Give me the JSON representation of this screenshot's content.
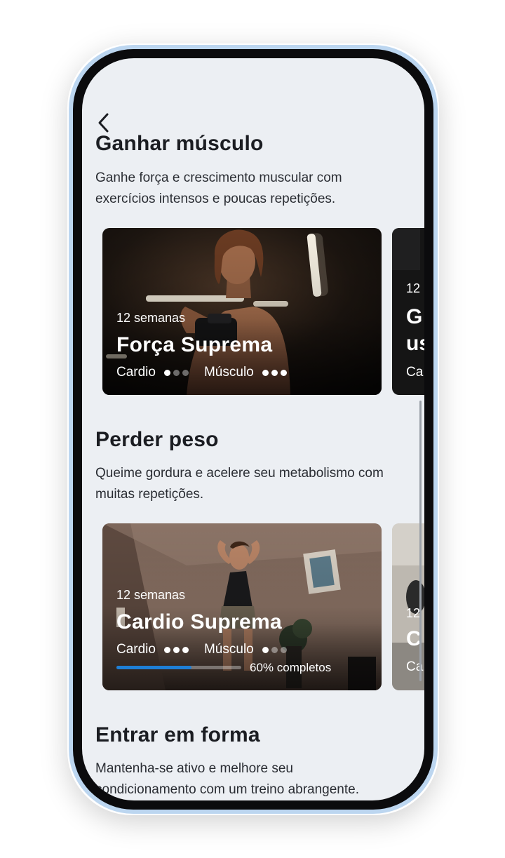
{
  "colors": {
    "screen_bg": "#eceff3",
    "text_primary": "#1b1d22",
    "frame_accent": "#bcd6f0",
    "progress_fill": "#1e7fd6"
  },
  "nav": {
    "back_icon": "chevron-left-icon"
  },
  "sections": [
    {
      "title": "Ganhar músculo",
      "description": "Ganhe força e crescimento muscular com exercícios intensos e poucas repetições.",
      "card": {
        "weeks": "12 semanas",
        "title": "Força Suprema",
        "cardio_label": "Cardio",
        "cardio_level": 1,
        "muscle_label": "Músculo",
        "muscle_level": 3
      },
      "peek_card": {
        "weeks": "12",
        "title_line1": "G",
        "title_line2": "us",
        "meta": "Ca"
      }
    },
    {
      "title": "Perder peso",
      "description": "Queime gordura e acelere seu metabolismo com muitas repetições.",
      "card": {
        "weeks": "12 semanas",
        "title": "Cardio Suprema",
        "cardio_label": "Cardio",
        "cardio_level": 3,
        "muscle_label": "Músculo",
        "muscle_level": 1,
        "progress": 0.6,
        "progress_label": "60% completos"
      },
      "peek_card": {
        "weeks": "12",
        "title_line1": "C",
        "meta": "Ca"
      }
    },
    {
      "title": "Entrar em forma",
      "description": "Mantenha-se ativo e melhore seu condicionamento com um treino abrangente."
    }
  ]
}
